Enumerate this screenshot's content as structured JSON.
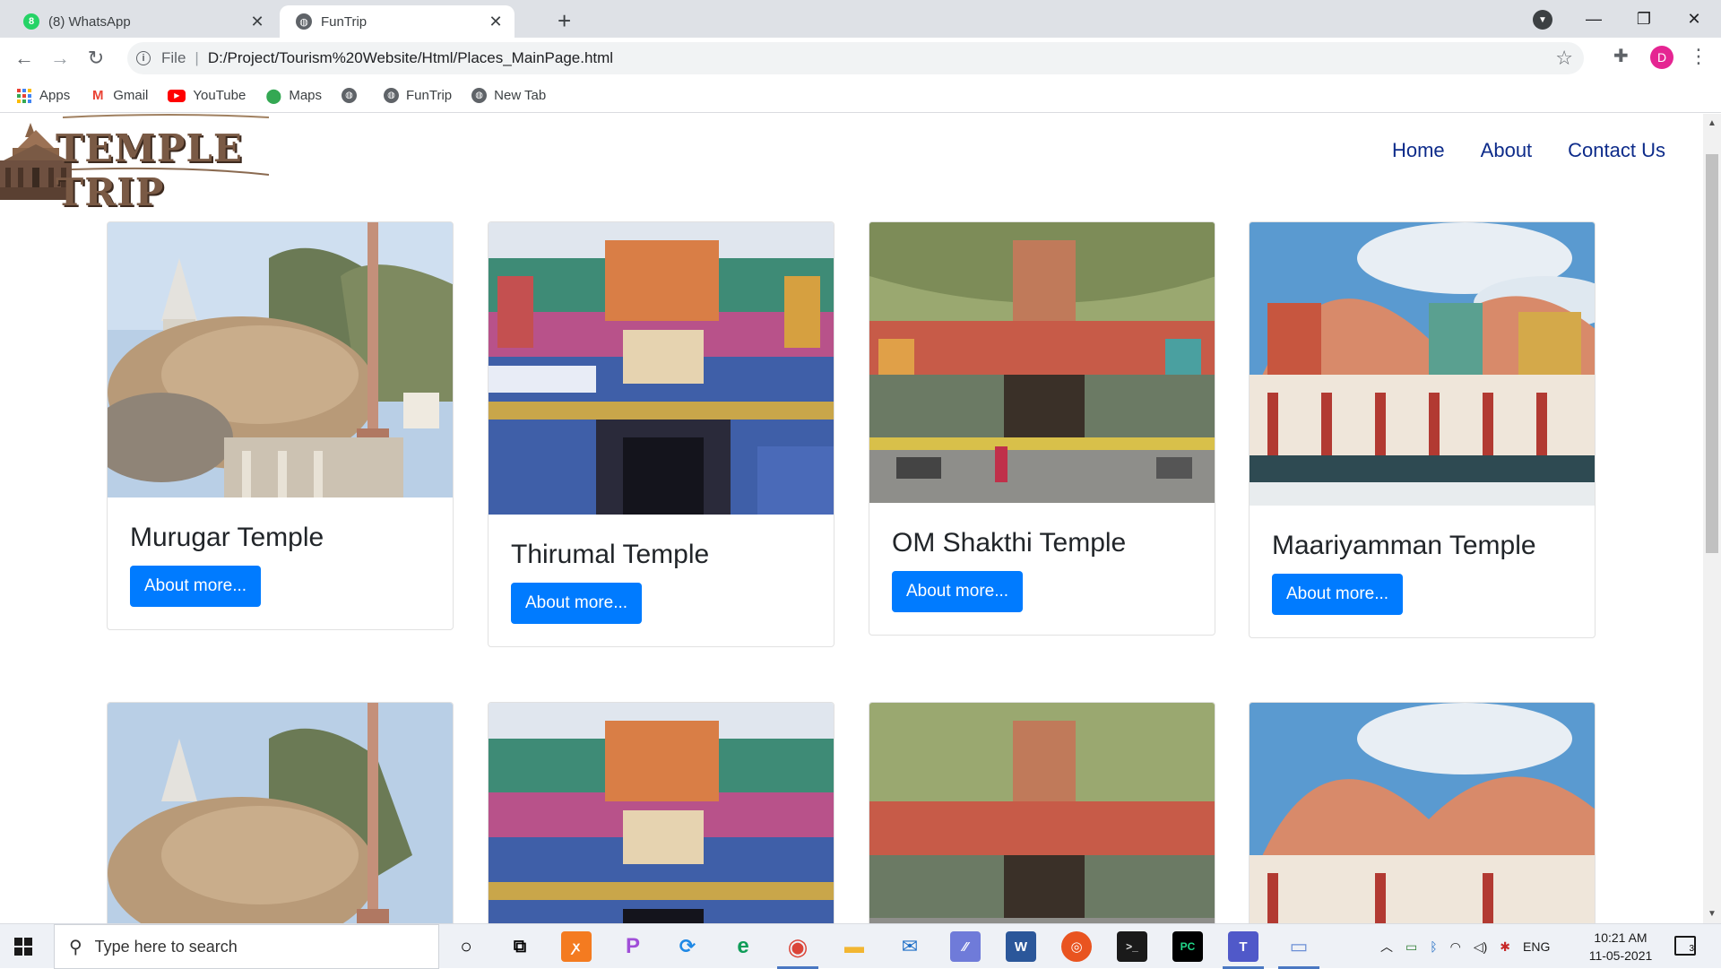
{
  "browser": {
    "tabs": [
      {
        "title": "(8) WhatsApp",
        "badge": "8",
        "active": false
      },
      {
        "title": "FunTrip",
        "active": true
      }
    ],
    "close_glyph": "✕",
    "new_tab_glyph": "+",
    "url_scheme": "File",
    "url": "D:/Project/Tourism%20Website/Html/Places_MainPage.html",
    "profile_initial": "D",
    "bookmarks": [
      {
        "label": "Apps",
        "icon": "apps-grid-icon"
      },
      {
        "label": "Gmail",
        "icon": "gmail-icon"
      },
      {
        "label": "YouTube",
        "icon": "youtube-icon"
      },
      {
        "label": "Maps",
        "icon": "maps-pin-icon"
      },
      {
        "label": "",
        "icon": "globe-icon"
      },
      {
        "label": "FunTrip",
        "icon": "globe-icon"
      },
      {
        "label": "New Tab",
        "icon": "globe-icon"
      }
    ]
  },
  "site": {
    "logo_text": "TEMPLE TRIP",
    "nav": [
      {
        "label": "Home"
      },
      {
        "label": "About"
      },
      {
        "label": "Contact Us"
      }
    ],
    "cards_row1": [
      {
        "title": "Murugar Temple",
        "button": "About more...",
        "image": "rock-temple-photo"
      },
      {
        "title": "Thirumal Temple",
        "button": "About more...",
        "image": "gopuram-blue-photo"
      },
      {
        "title": "OM Shakthi Temple",
        "button": "About more...",
        "image": "street-temple-photo"
      },
      {
        "title": "Maariyamman Temple",
        "button": "About more...",
        "image": "sky-gopuram-photo"
      }
    ]
  },
  "taskbar": {
    "search_placeholder": "Type here to search",
    "language": "ENG",
    "time": "10:21 AM",
    "date": "11-05-2021",
    "notification_count": "3"
  },
  "colors": {
    "button_blue": "#007bff",
    "nav_link": "#0d2b8a",
    "logo_brown": "#7a5a45"
  }
}
